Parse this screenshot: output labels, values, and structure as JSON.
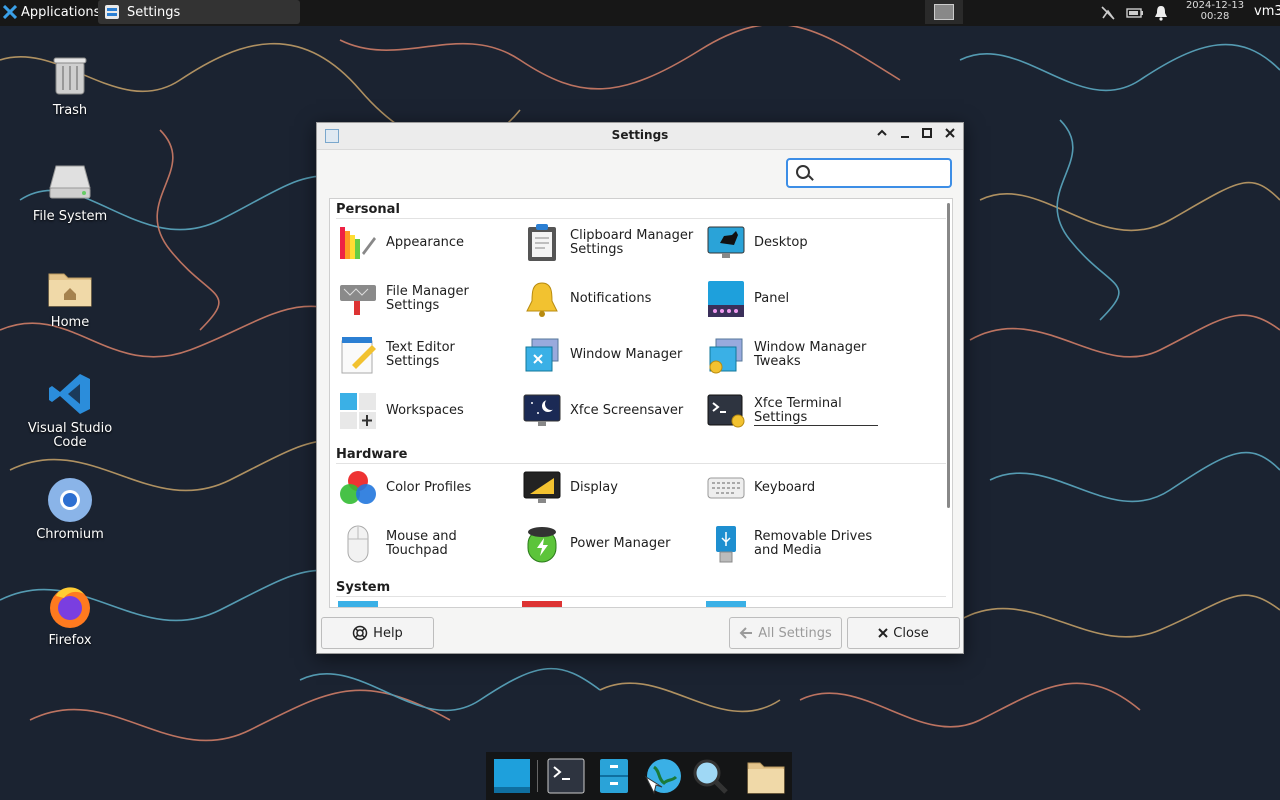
{
  "top_panel": {
    "applications_label": "Applications",
    "active_window_label": "Settings",
    "clock_date": "2024-12-13",
    "clock_time": "00:28",
    "user_label": "vm3",
    "tray_icons": [
      "network-disconnected-icon",
      "battery-icon",
      "notification-bell-icon"
    ]
  },
  "desktop_icons": {
    "trash": "Trash",
    "file_system": "File System",
    "home": "Home",
    "vscode": "Visual Studio Code",
    "chromium": "Chromium",
    "firefox": "Firefox"
  },
  "window": {
    "title": "Settings",
    "search": {
      "value": "",
      "placeholder": ""
    },
    "categories": {
      "personal": "Personal",
      "hardware": "Hardware",
      "system": "System"
    },
    "personal_items": {
      "appearance": "Appearance",
      "clipboard": "Clipboard Manager Settings",
      "desktop": "Desktop",
      "file_manager": "File Manager Settings",
      "notifications": "Notifications",
      "panel": "Panel",
      "text_editor": "Text Editor Settings",
      "window_manager": "Window Manager",
      "wm_tweaks": "Window Manager Tweaks",
      "workspaces": "Workspaces",
      "screensaver": "Xfce Screensaver",
      "terminal": "Xfce Terminal Settings"
    },
    "hardware_items": {
      "color_profiles": "Color Profiles",
      "display": "Display",
      "keyboard": "Keyboard",
      "mouse": "Mouse and Touchpad",
      "power": "Power Manager",
      "removable": "Removable Drives and Media"
    },
    "buttons": {
      "help": "Help",
      "all_settings": "All Settings",
      "close": "Close"
    }
  },
  "dock_items": [
    "show-desktop",
    "terminal",
    "file-manager",
    "web-browser",
    "app-finder",
    "home-folder"
  ]
}
